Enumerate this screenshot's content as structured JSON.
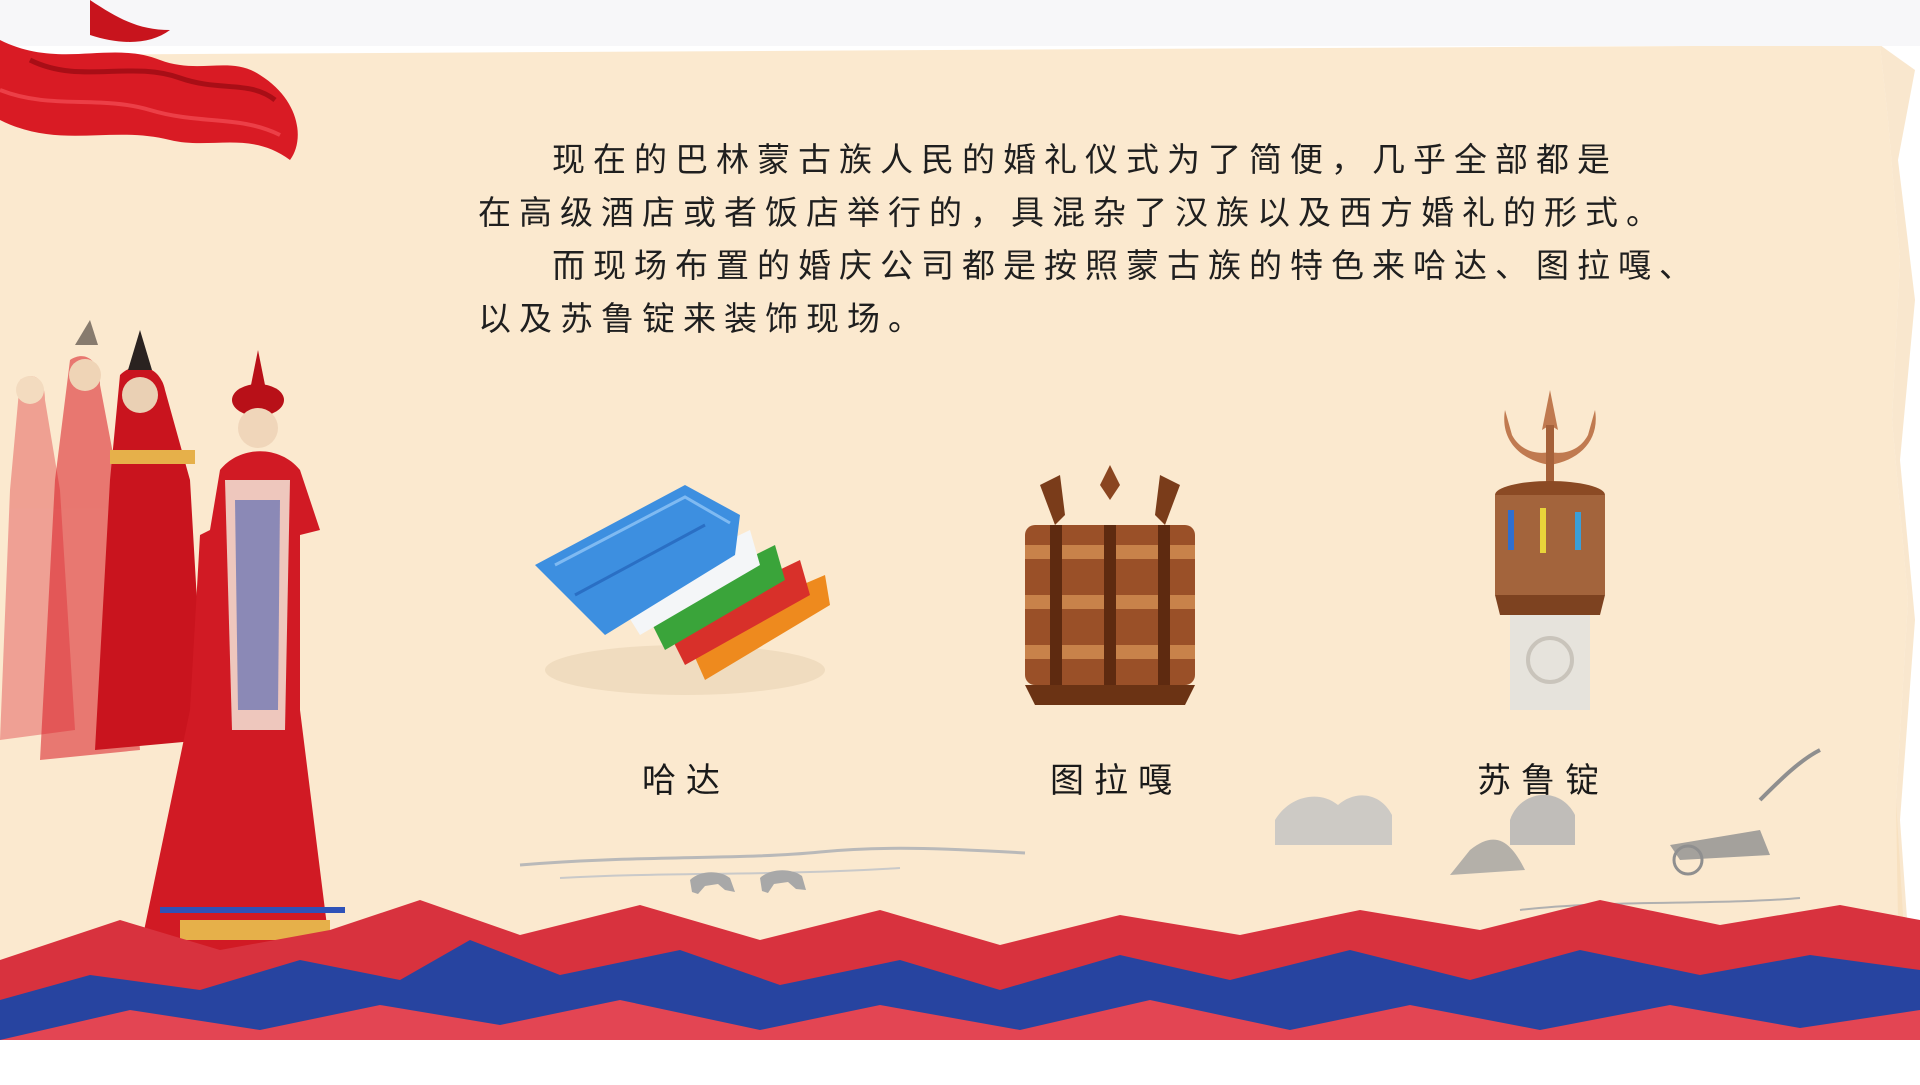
{
  "intro": {
    "line1": "现在的巴林蒙古族人民的婚礼仪式为了简便，几乎全部都是",
    "line2": "在高级酒店或者饭店举行的，具混杂了汉族以及西方婚礼的形式。",
    "line3": "而现场布置的婚庆公司都是按照蒙古族的特色来哈达、图拉嘎、",
    "line4": "以及苏鲁锭来装饰现场。"
  },
  "items": [
    {
      "label": "哈达",
      "icon": "khata-scarves-image"
    },
    {
      "label": "图拉嘎",
      "icon": "tulaga-hearth-frame-image"
    },
    {
      "label": "苏鲁锭",
      "icon": "suld-trident-standard-image"
    }
  ],
  "colors": {
    "paper": "#fbe9cf",
    "ribbon_red": "#d91b24",
    "mountain_red": "#d8323e",
    "mountain_blue": "#2744a0",
    "sketch_gray": "#9a9a9a"
  }
}
